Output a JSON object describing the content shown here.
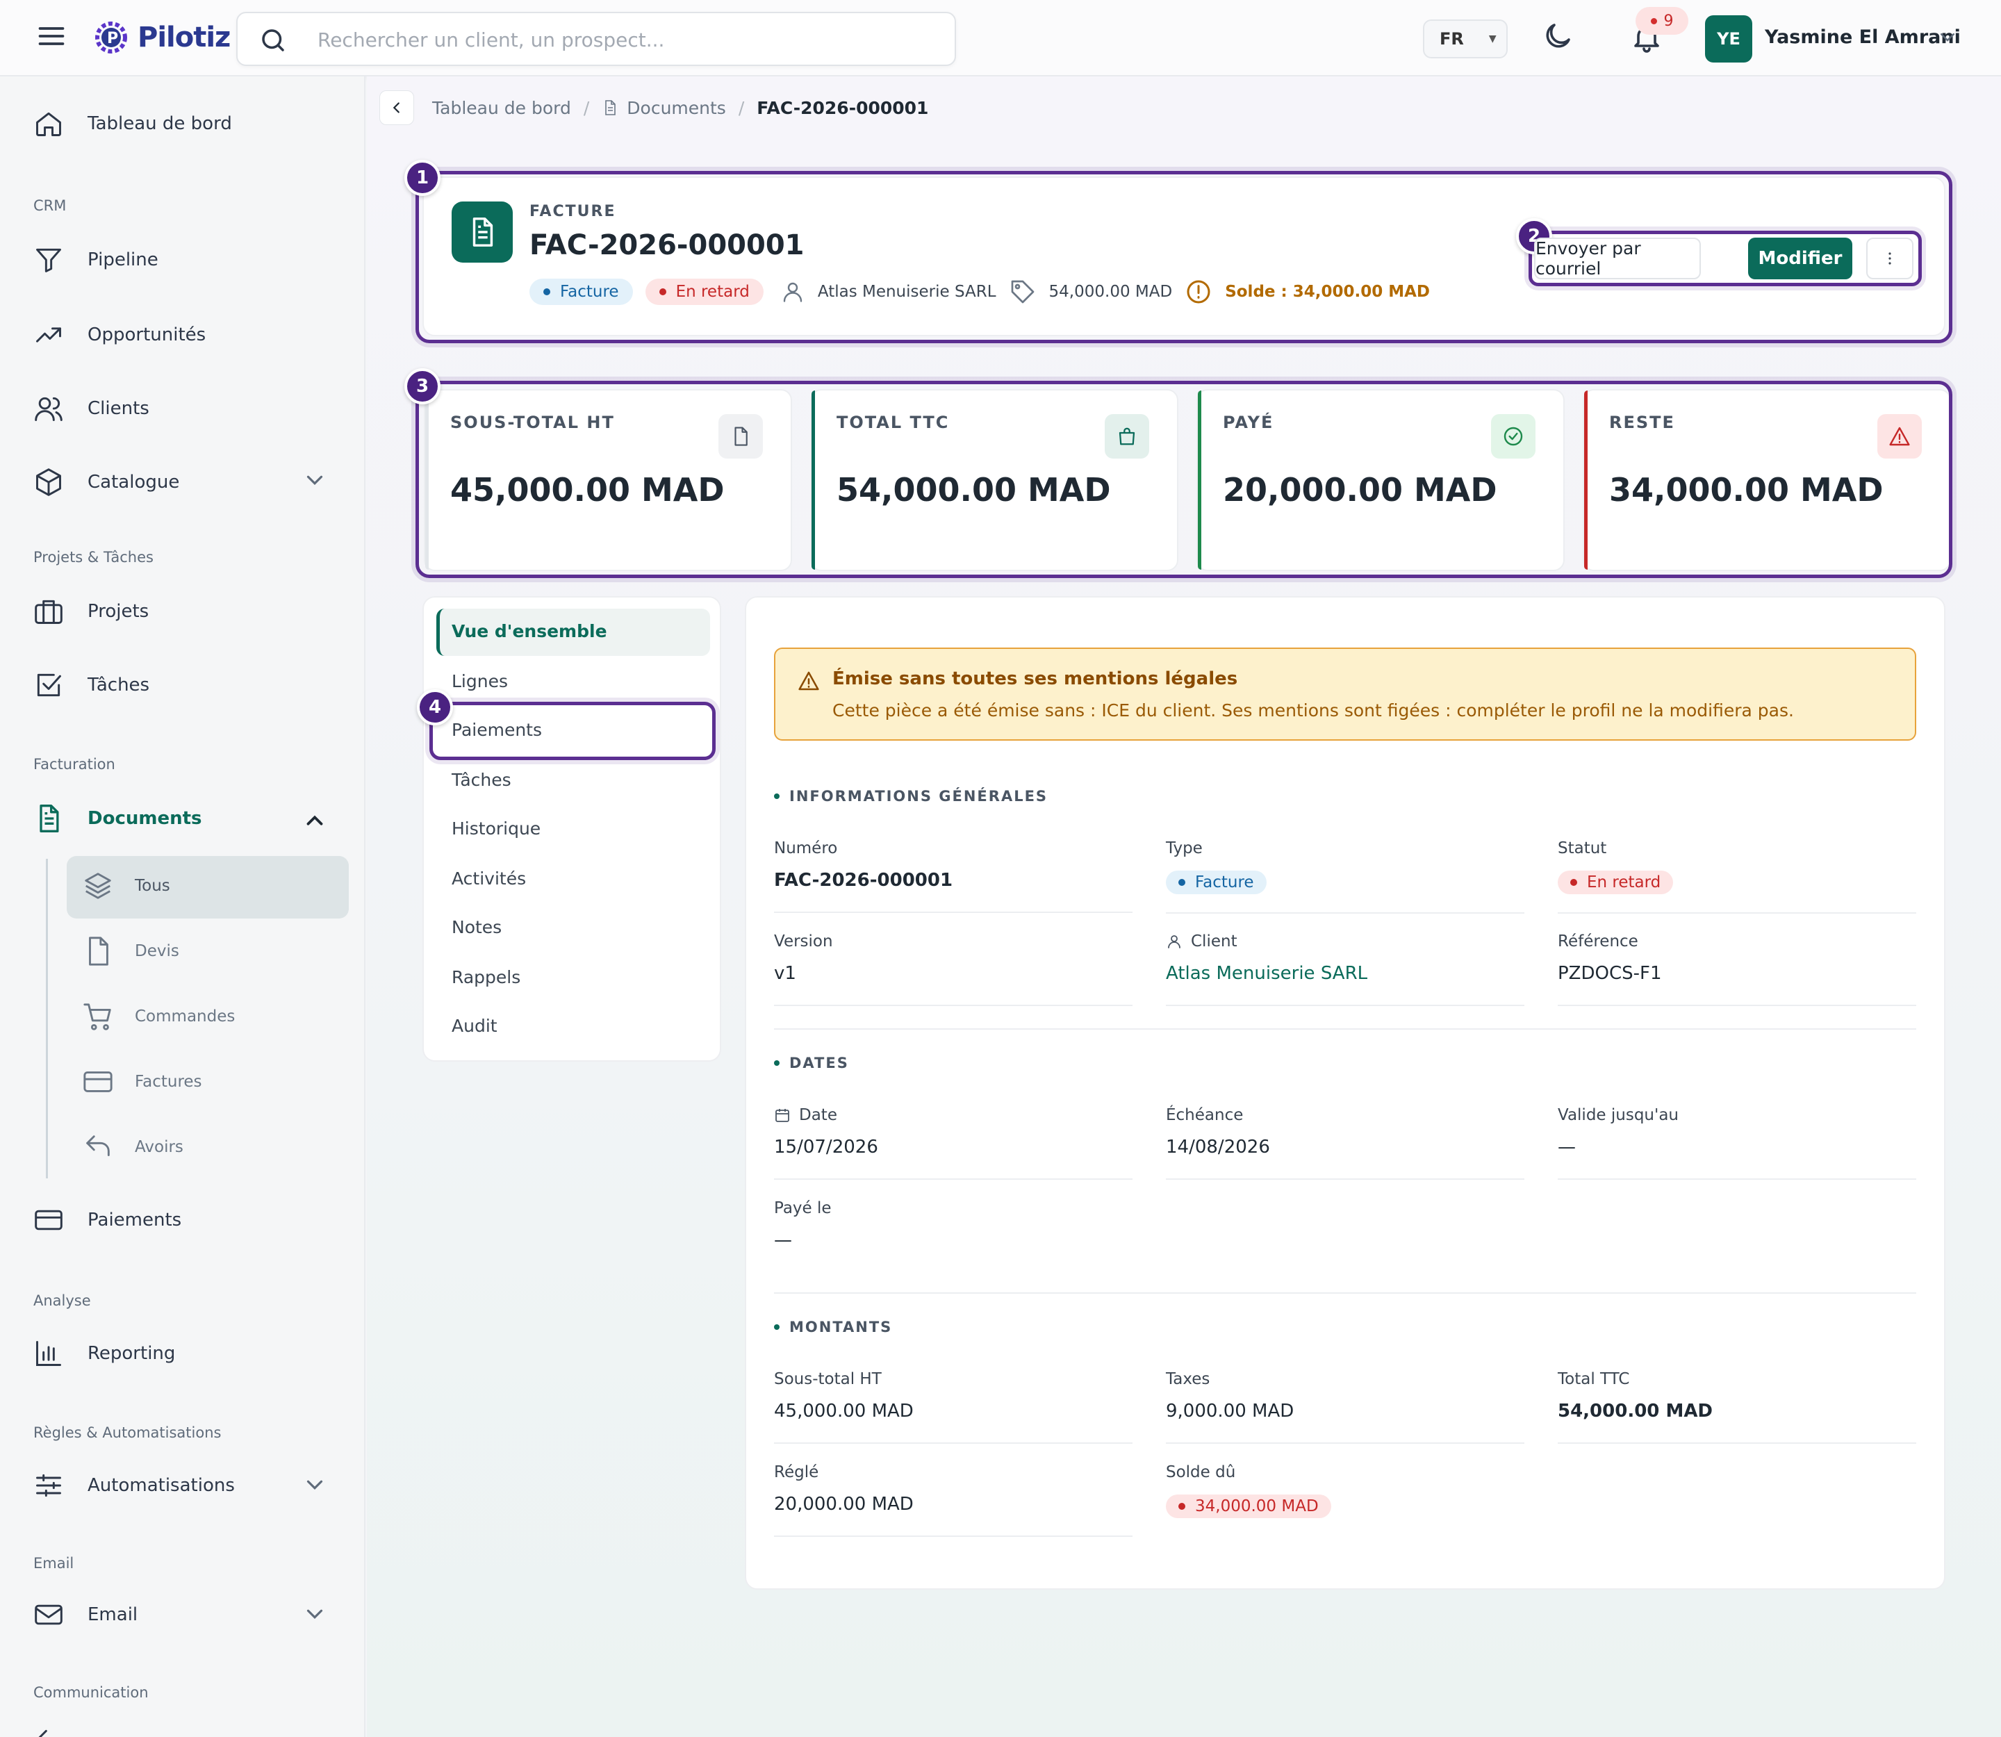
{
  "app": {
    "brand": "Pilotiz",
    "language": "FR",
    "notifications": "9",
    "user_initials": "YE",
    "user_name": "Yasmine El Amrani"
  },
  "search": {
    "placeholder": "Rechercher un client, un prospect..."
  },
  "sidebar": {
    "dashboard": "Tableau de bord",
    "sections": {
      "crm": "CRM",
      "projects": "Projets & Tâches",
      "billing": "Facturation",
      "analysis": "Analyse",
      "rules": "Règles & Automatisations",
      "email": "Email",
      "communication": "Communication"
    },
    "items": {
      "pipeline": "Pipeline",
      "opportunities": "Opportunités",
      "clients": "Clients",
      "catalogue": "Catalogue",
      "projects": "Projets",
      "tasks": "Tâches",
      "documents": "Documents",
      "payments": "Paiements",
      "reporting": "Reporting",
      "automations": "Automatisations",
      "email": "Email"
    },
    "documents_sub": {
      "all": "Tous",
      "quotes": "Devis",
      "orders": "Commandes",
      "invoices": "Factures",
      "credits": "Avoirs"
    }
  },
  "breadcrumb": {
    "home": "Tableau de bord",
    "section": "Documents",
    "current": "FAC-2026-000001"
  },
  "header": {
    "kicker": "FACTURE",
    "title": "FAC-2026-000001",
    "type_badge": "Facture",
    "status_badge": "En retard",
    "client": "Atlas Menuiserie SARL",
    "amount": "54,000.00 MAD",
    "balance": "Solde : 34,000.00 MAD",
    "send_button": "Envoyer par courriel",
    "edit_button": "Modifier"
  },
  "annotations": {
    "n1": "1",
    "n2": "2",
    "n3": "3",
    "n4": "4"
  },
  "kpis": [
    {
      "label": "SOUS-TOTAL HT",
      "value": "45,000.00 MAD",
      "accent": "#d8dde2"
    },
    {
      "label": "TOTAL TTC",
      "value": "54,000.00 MAD",
      "accent": "#0b6b5a"
    },
    {
      "label": "PAYÉ",
      "value": "20,000.00 MAD",
      "accent": "#1e8a4c"
    },
    {
      "label": "RESTE",
      "value": "34,000.00 MAD",
      "accent": "#c62828"
    }
  ],
  "tabs": [
    "Vue d'ensemble",
    "Lignes",
    "Paiements",
    "Tâches",
    "Historique",
    "Activités",
    "Notes",
    "Rappels",
    "Audit"
  ],
  "alert": {
    "title": "Émise sans toutes ses mentions légales",
    "text": "Cette pièce a été émise sans : ICE du client. Ses mentions sont figées : compléter le profil ne la modifiera pas."
  },
  "general": {
    "heading": "INFORMATIONS GÉNÉRALES",
    "number_label": "Numéro",
    "number": "FAC-2026-000001",
    "type_label": "Type",
    "type": "Facture",
    "status_label": "Statut",
    "status": "En retard",
    "version_label": "Version",
    "version": "v1",
    "client_label": "Client",
    "client": "Atlas Menuiserie SARL",
    "reference_label": "Référence",
    "reference": "PZDOCS-F1"
  },
  "dates": {
    "heading": "DATES",
    "date_label": "Date",
    "date": "15/07/2026",
    "due_label": "Échéance",
    "due": "14/08/2026",
    "valid_label": "Valide jusqu'au",
    "valid": "—",
    "paid_label": "Payé le",
    "paid": "—"
  },
  "amounts": {
    "heading": "MONTANTS",
    "subtotal_label": "Sous-total HT",
    "subtotal": "45,000.00 MAD",
    "taxes_label": "Taxes",
    "taxes": "9,000.00 MAD",
    "total_label": "Total TTC",
    "total": "54,000.00 MAD",
    "settled_label": "Réglé",
    "settled": "20,000.00 MAD",
    "due_label": "Solde dû",
    "due": "34,000.00 MAD"
  }
}
